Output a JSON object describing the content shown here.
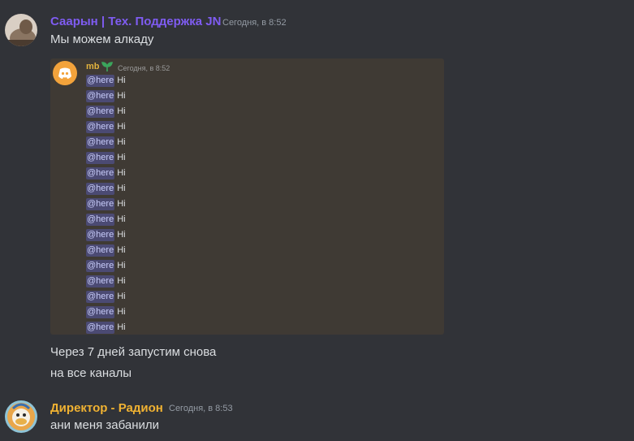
{
  "messages": {
    "first": {
      "author": "Саарын | Тех. Поддержка JN",
      "author_color": "#7f5cf2",
      "time": "Сегодня, в 8:52",
      "text": "Мы можем алкаду"
    },
    "embed": {
      "author": "mb",
      "time": "Сегодня, в 8:52",
      "lines": [
        {
          "mention": "@here",
          "text": "Hi"
        },
        {
          "mention": "@here",
          "text": "Hi"
        },
        {
          "mention": "@here",
          "text": "Hi"
        },
        {
          "mention": "@here",
          "text": "Hi"
        },
        {
          "mention": "@here",
          "text": "Hi"
        },
        {
          "mention": "@here",
          "text": "Hi"
        },
        {
          "mention": "@here",
          "text": "Hi"
        },
        {
          "mention": "@here",
          "text": "Hi"
        },
        {
          "mention": "@here",
          "text": "Hi"
        },
        {
          "mention": "@here",
          "text": "Hi"
        },
        {
          "mention": "@here",
          "text": "Hi"
        },
        {
          "mention": "@here",
          "text": "Hi"
        },
        {
          "mention": "@here",
          "text": "Hi"
        },
        {
          "mention": "@here",
          "text": "Hi"
        },
        {
          "mention": "@here",
          "text": "Hi"
        },
        {
          "mention": "@here",
          "text": "Hi"
        },
        {
          "mention": "@here",
          "text": "Hi"
        }
      ]
    },
    "followups": [
      "Через 7 дней запустим снова",
      "на все каналы"
    ],
    "second": {
      "author": "Директор - Радион",
      "author_color": "#f0b232",
      "time": "Сегодня, в 8:53",
      "text": "ани меня забанили"
    }
  }
}
